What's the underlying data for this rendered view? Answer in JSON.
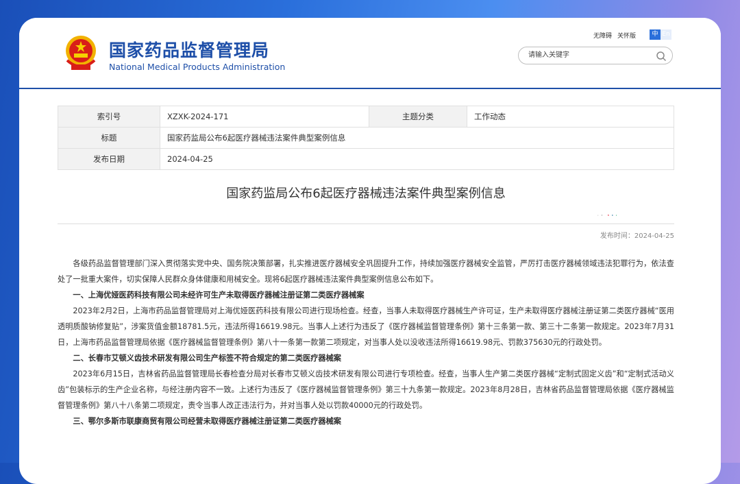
{
  "site": {
    "name_cn": "国家药品监督管理局",
    "name_en": "National Medical Products Administration",
    "accessibility_link": "无障碍",
    "care_mode_link": "关怀版",
    "lang_zh": "中",
    "lang_en": "En",
    "search_placeholder": "请输入关键字",
    "brand_color": "#1e4fa8",
    "social_icons": [
      "weibo-icon",
      "wechat-icon",
      "mobile-icon",
      "mail-icon",
      "user-icon"
    ]
  },
  "meta": {
    "index_label": "索引号",
    "index_value": "XZXK-2024-171",
    "topic_label": "主题分类",
    "topic_value": "工作动态",
    "title_label": "标题",
    "title_value": "国家药监局公布6起医疗器械违法案件典型案例信息",
    "date_label": "发布日期",
    "date_value": "2024-04-25"
  },
  "article": {
    "title": "国家药监局公布6起医疗器械违法案件典型案例信息",
    "publish_time": "发布时间：2024-04-25",
    "tool_icons": [
      "download-icon",
      "print-icon",
      "weibo-share-icon",
      "favorite-icon",
      "wechat-share-icon"
    ],
    "paragraphs": [
      "各级药品监督管理部门深入贯彻落实党中央、国务院决策部署，扎实推进医疗器械安全巩固提升工作，持续加强医疗器械安全监管，严厉打击医疗器械领域违法犯罪行为，依法查处了一批重大案件，切实保障人民群众身体健康和用械安全。现将6起医疗器械违法案件典型案例信息公布如下。",
      "一、上海优娅医药科技有限公司未经许可生产未取得医疗器械注册证第二类医疗器械案",
      "2023年2月2日，上海市药品监督管理局对上海优娅医药科技有限公司进行现场检查。经查，当事人未取得医疗器械生产许可证，生产未取得医疗器械注册证第二类医疗器械“医用透明质酸钠修复贴”，涉案货值金额18781.5元，违法所得16619.98元。当事人上述行为违反了《医疗器械监督管理条例》第十三条第一款、第三十二条第一款规定。2023年7月31日，上海市药品监督管理局依据《医疗器械监督管理条例》第八十一条第一款第二项规定，对当事人处以没收违法所得16619.98元、罚款375630元的行政处罚。",
      "二、长春市艾顿义齿技术研发有限公司生产标签不符合规定的第二类医疗器械案",
      "2023年6月15日，吉林省药品监督管理局长春检查分局对长春市艾顿义齿技术研发有限公司进行专项检查。经查，当事人生产第二类医疗器械“定制式固定义齿”和“定制式活动义齿”包装标示的生产企业名称，与经注册内容不一致。上述行为违反了《医疗器械监督管理条例》第三十九条第一款规定。2023年8月28日，吉林省药品监督管理局依据《医疗器械监督管理条例》第八十八条第二项规定，责令当事人改正违法行为，并对当事人处以罚款40000元的行政处罚。",
      "三、鄂尔多斯市联康商贸有限公司经营未取得医疗器械注册证第二类医疗器械案"
    ]
  }
}
